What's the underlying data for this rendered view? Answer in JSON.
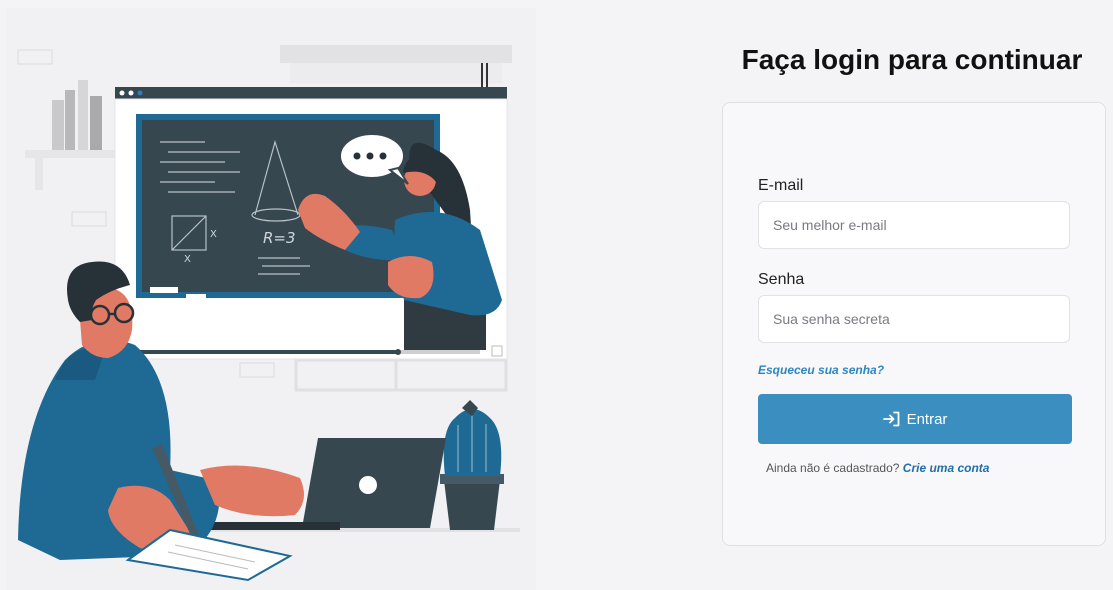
{
  "page": {
    "title": "Faça login para continuar"
  },
  "form": {
    "email_label": "E-mail",
    "email_placeholder": "Seu melhor e-mail",
    "email_value": "",
    "password_label": "Senha",
    "password_placeholder": "Sua senha secreta",
    "password_value": "",
    "forgot_link": "Esqueceu sua senha?",
    "submit_label": "Entrar",
    "submit_icon": "sign-in-icon",
    "signup_prompt": "Ainda não é cadastrado?",
    "signup_link": "Crie uma conta"
  },
  "illustration": {
    "board_formula": "R=3",
    "speech_bubble_icon": "ellipsis-icon"
  },
  "colors": {
    "accent": "#3a8ec0",
    "link": "#2e86c1",
    "navy": "#1f6a94",
    "skin": "#e07a65",
    "chalkboard": "#37474f"
  }
}
